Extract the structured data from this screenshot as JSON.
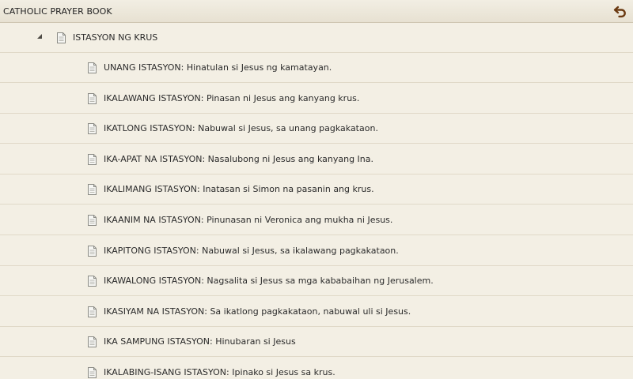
{
  "app": {
    "title": "CATHOLIC PRAYER BOOK"
  },
  "icons": {
    "back": "back-arrow-icon",
    "document": "document-icon",
    "expander": "expanded-triangle-icon"
  },
  "colors": {
    "background": "#f3efe4",
    "titlebar": "#ebe6d8",
    "back_icon": "#6b3a12",
    "text": "#2b2b2b"
  },
  "tree": {
    "parent_label": "ISTASYON NG KRUS",
    "items": [
      {
        "label": "UNANG ISTASYON: Hinatulan si Jesus ng kamatayan."
      },
      {
        "label": "IKALAWANG ISTASYON: Pinasan ni Jesus ang kanyang krus."
      },
      {
        "label": "IKATLONG ISTASYON: Nabuwal si Jesus, sa unang pagkakataon."
      },
      {
        "label": "IKA-APAT NA ISTASYON: Nasalubong ni Jesus ang kanyang Ina."
      },
      {
        "label": "IKALIMANG ISTASYON: Inatasan si Simon na pasanin ang krus."
      },
      {
        "label": "IKAANIM NA ISTASYON: Pinunasan ni Veronica ang mukha ni Jesus."
      },
      {
        "label": "IKAPITONG ISTASYON: Nabuwal si Jesus, sa ikalawang pagkakataon."
      },
      {
        "label": "IKAWALONG ISTASYON: Nagsalita si Jesus sa mga kababaihan ng Jerusalem."
      },
      {
        "label": "IKASIYAM NA ISTASYON: Sa ikatlong pagkakataon, nabuwal uli si Jesus."
      },
      {
        "label": "IKA SAMPUNG ISTASYON: Hinubaran si Jesus"
      },
      {
        "label": "IKALABING-ISANG ISTASYON: Ipinako si Jesus sa krus."
      }
    ]
  }
}
